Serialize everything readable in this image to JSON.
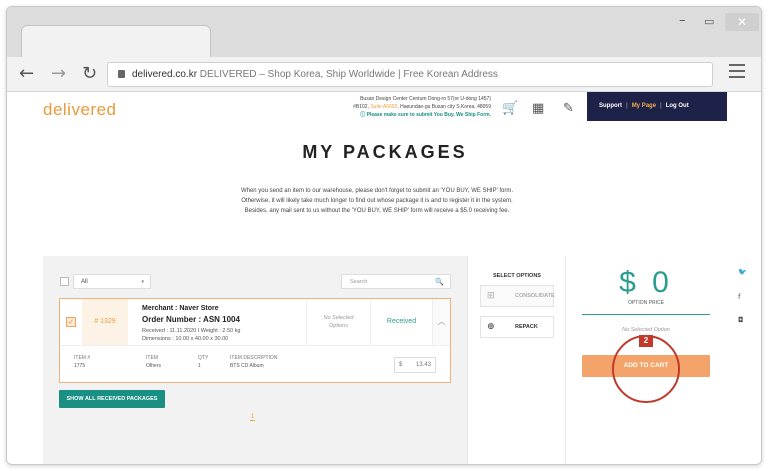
{
  "browser": {
    "window_controls": {
      "minimize": "–",
      "maximize": "▭",
      "close": "✕"
    },
    "nav": {
      "back": "←",
      "forward": "→",
      "reload": "↻"
    },
    "url_domain": "delivered.co.kr",
    "url_title": "  DELIVERED – Shop Korea, Ship Worldwide | Free Korean Address",
    "menu_icon": "hamburger-icon"
  },
  "header": {
    "logo": "delivered",
    "address_line1": "Busan Design Center Centum Dong-ro 57(or U-dong 1457)",
    "address_line2_pre": "#B102, ",
    "address_suite": "Suite A6602",
    "address_line2_post": ", Haeundae-gu Busan city S.Korea, 48059",
    "address_note": "ⓘ Please make sure to submit You Buy, We Ship Form.",
    "icons": {
      "cart": "🛒",
      "calculator": "▦",
      "form": "✎"
    },
    "support": "Support",
    "my_page": "My Page",
    "logout": "Log Out",
    "separator": "|"
  },
  "page": {
    "title": "MY PACKAGES",
    "intro_line1": "When you send an item to our warehouse, please don't forget to submit an 'YOU BUY, WE SHIP' form.",
    "intro_line2": "Otherwise, it will likely take much longer to find out whose package it is and to register it in the system.",
    "intro_line3": "Besides, any mail sent to us without the 'YOU BUY, WE SHIP' form will receive a $5.0 receiving fee."
  },
  "list": {
    "filter_value": "All",
    "filter_caret": "▾",
    "search_placeholder": "Search",
    "search_icon": "🔍",
    "package": {
      "check": "✓",
      "number": "# 1329",
      "merchant": "Merchant : Naver Store",
      "order": "Order Number : ASN 1004",
      "received_weight": "Received : 11.11.2020   I   Weight : 2.50 kg",
      "dimensions": "Dimensions : 10.00 x 40.00 x 30.00",
      "options_line1": "No Selected",
      "options_line2": "Options",
      "status": "Received",
      "expand": "︿",
      "columns": {
        "item_no_label": "ITEM #",
        "item_no": "1775",
        "item_label": "ITEM",
        "item": "Others",
        "qty_label": "QTY",
        "qty": "1",
        "desc_label": "ITEM DESCRIPTION",
        "desc": "BTS CD Album"
      },
      "price_currency": "$",
      "price": "13.43"
    },
    "show_all": "SHOW ALL RECEIVED PACKAGES",
    "page_number": "1"
  },
  "options": {
    "title": "SELECT OPTIONS",
    "consolidate": "CONSOLIDATE",
    "consolidate_icon": "⊞",
    "repack": "REPACK",
    "repack_icon": "⊕"
  },
  "summary": {
    "price": "$ 0",
    "label": "OPTION PRICE",
    "no_selected": "No Selected Option",
    "add_to_cart": "ADD TO CART",
    "step_badge": "2"
  },
  "social": {
    "twitter": "🐦",
    "facebook": "f",
    "instagram": "◘"
  }
}
